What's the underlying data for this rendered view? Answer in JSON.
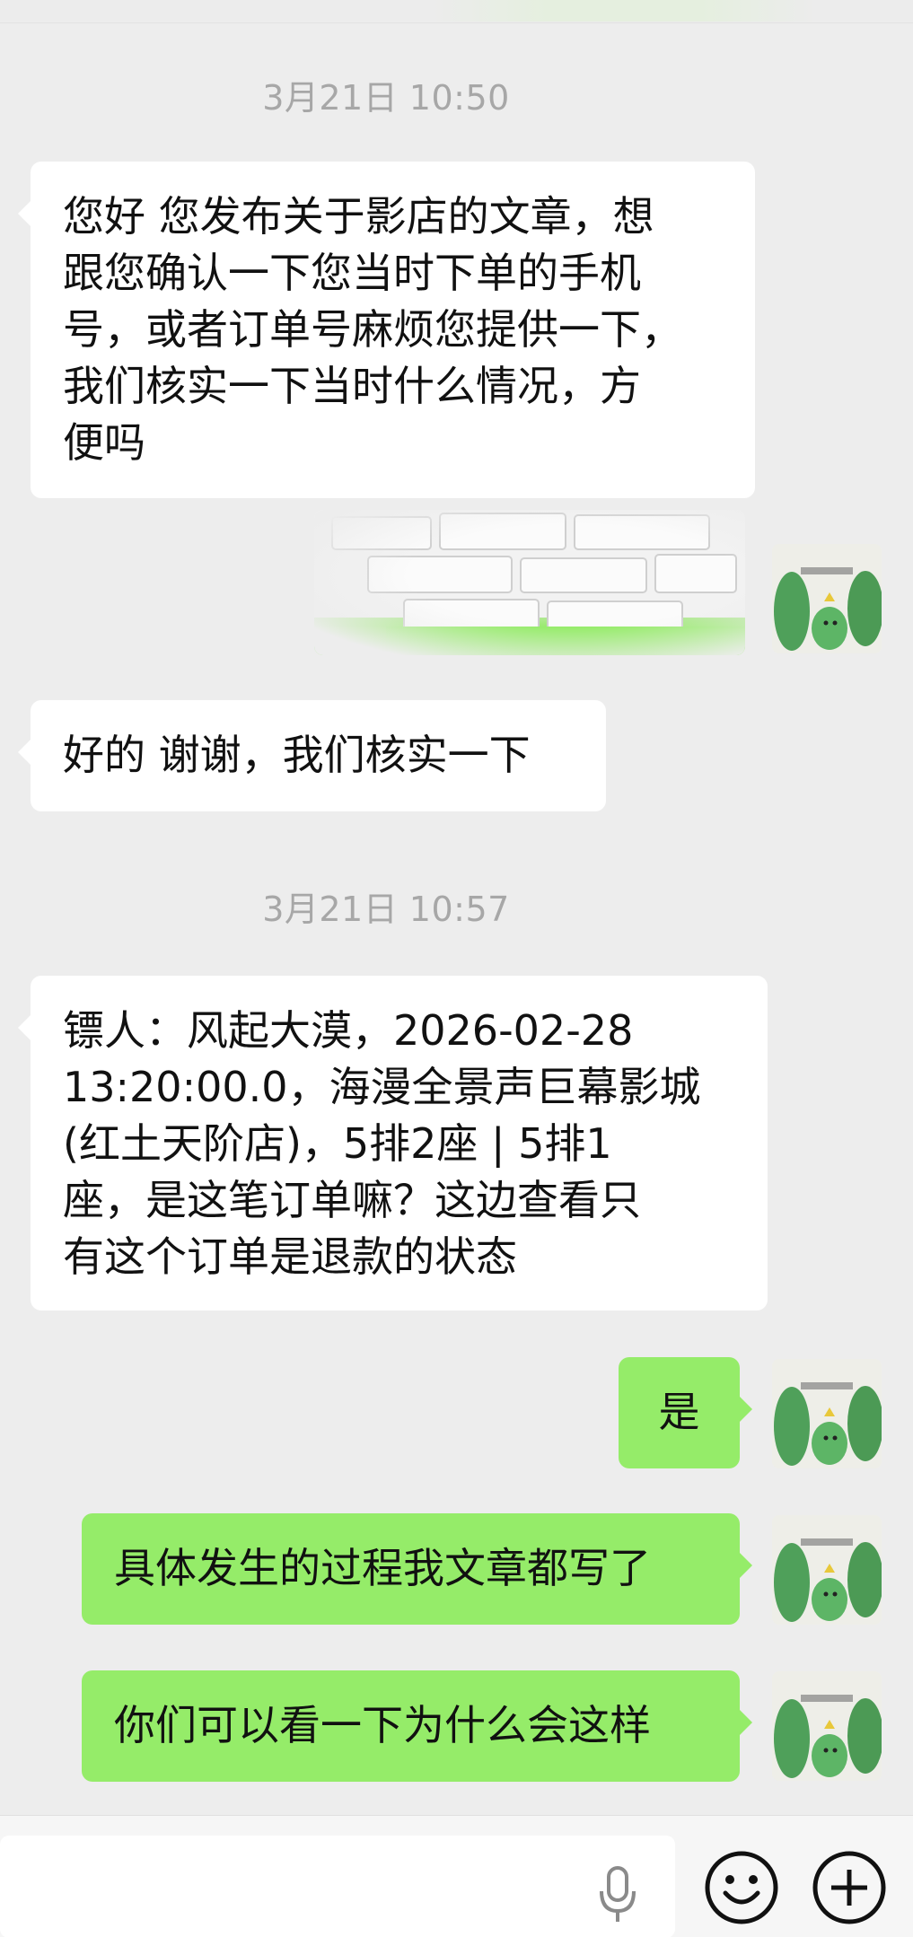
{
  "timestamps": [
    "3月21日 10:50",
    "3月21日 10:57"
  ],
  "messages": [
    {
      "side": "left",
      "text": "您好 您发布关于影店的文章，想\n跟您确认一下您当时下单的手机\n号，或者订单号麻烦您提供一下，\n我们核实一下当时什么情况，方\n便吗"
    },
    {
      "side": "right",
      "type": "image"
    },
    {
      "side": "left",
      "text": "好的 谢谢，我们核实一下"
    },
    {
      "side": "left",
      "text": "镖人：风起大漠，2026-02-28\n13:20:00.0，海漫全景声巨幕影城\n(红土天阶店)，5排2座 | 5排1\n座，是这笔订单嘛？这边查看只\n有这个订单是退款的状态"
    },
    {
      "side": "right",
      "text": "是"
    },
    {
      "side": "right",
      "text": "具体发生的过程我文章都写了"
    },
    {
      "side": "right",
      "text": "你们可以看一下为什么会这样"
    }
  ],
  "avatar": {
    "caption": "三只绿色小怪兽"
  },
  "inputbar": {
    "icons": [
      "microphone-icon",
      "emoji-icon",
      "plus-icon"
    ]
  },
  "colors": {
    "background": "#ededed",
    "bubble_left": "#ffffff",
    "bubble_right": "#95ec69",
    "timestamp": "#a7a7a7"
  }
}
